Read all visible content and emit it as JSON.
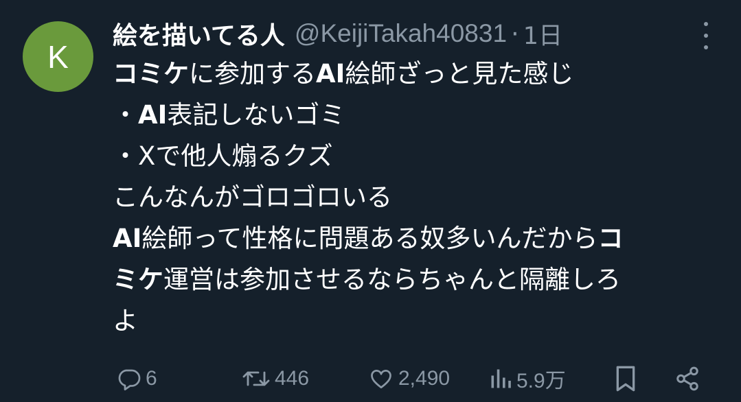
{
  "author": {
    "avatar_letter": "K",
    "avatar_color": "#6a9a3c",
    "display_name": "絵を描いてる人",
    "handle": "@KeijiTakah40831",
    "separator": "·",
    "time": "1日"
  },
  "tweet_lines": [
    [
      {
        "text": "コミケ",
        "bold": true
      },
      {
        "text": "に参加する",
        "bold": false
      },
      {
        "text": "AI",
        "bold": true
      },
      {
        "text": "絵師ざっと見た感じ",
        "bold": false
      }
    ],
    [
      {
        "text": "・",
        "bold": false
      },
      {
        "text": "AI",
        "bold": true
      },
      {
        "text": "表記しないゴミ",
        "bold": false
      }
    ],
    [
      {
        "text": "・Xで他人煽るクズ",
        "bold": false
      }
    ],
    [
      {
        "text": "こんなんがゴロゴロいる",
        "bold": false
      }
    ],
    [
      {
        "text": "AI",
        "bold": true
      },
      {
        "text": "絵師って性格に問題ある奴多いんだから",
        "bold": false
      },
      {
        "text": "コ",
        "bold": true
      }
    ],
    [
      {
        "text": "ミケ",
        "bold": true
      },
      {
        "text": "運営は参加させるならちゃんと隔離しろ",
        "bold": false
      }
    ],
    [
      {
        "text": "よ",
        "bold": false
      }
    ]
  ],
  "actions": {
    "reply_count": "6",
    "retweet_count": "446",
    "like_count": "2,490",
    "views_count": "5.9万"
  },
  "icons": {
    "more": "more-vertical-icon",
    "reply": "reply-icon",
    "retweet": "retweet-icon",
    "like": "heart-icon",
    "views": "views-chart-icon",
    "bookmark": "bookmark-icon",
    "share": "share-icon"
  },
  "colors": {
    "background": "#15202b",
    "text": "#ffffff",
    "muted": "#8b98a5"
  }
}
